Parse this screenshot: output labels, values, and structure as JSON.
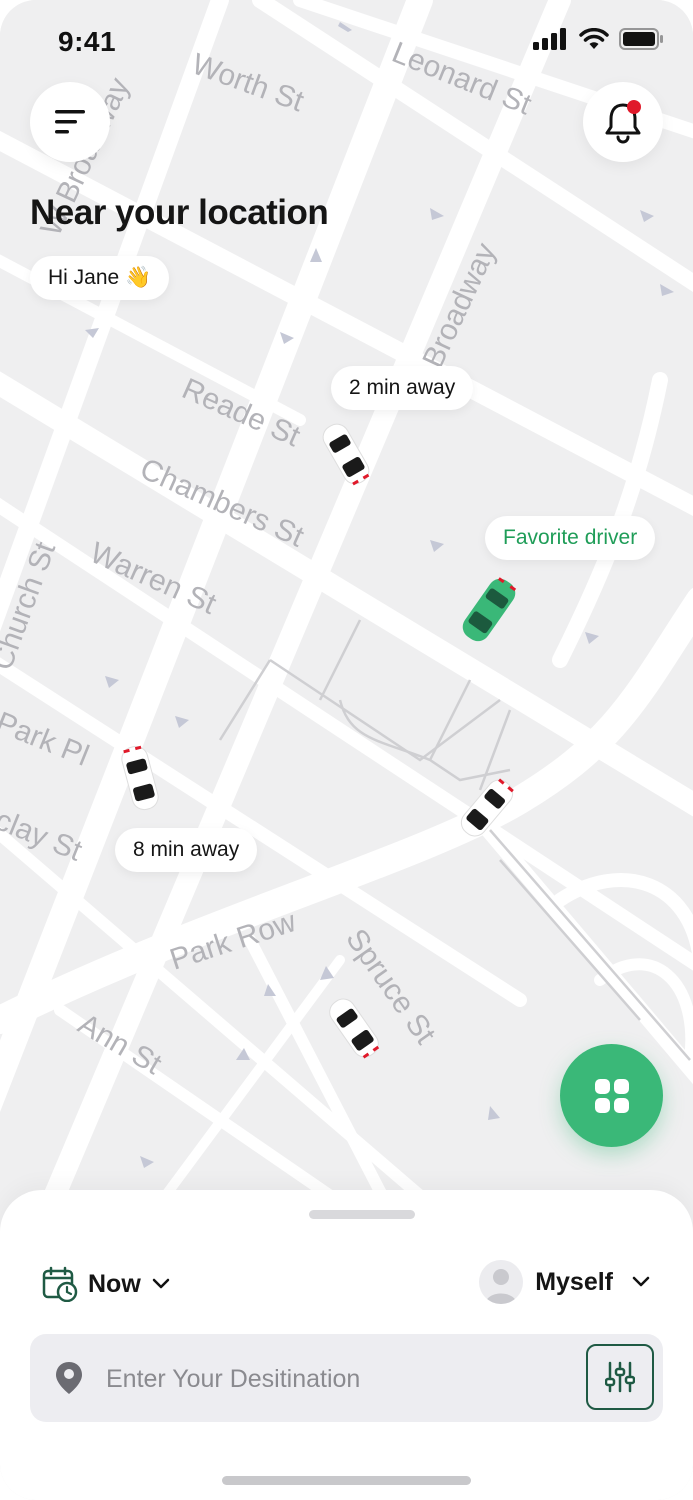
{
  "status_bar": {
    "time": "9:41"
  },
  "header": {
    "title": "Near your location",
    "greeting": "Hi Jane 👋"
  },
  "map": {
    "street_labels": [
      "Worth St",
      "Leonard St",
      "W Broadway",
      "Broadway",
      "Reade St",
      "Chambers St",
      "Warren St",
      "Church St",
      "Park Pl",
      "Barclay St",
      "Park Row",
      "Spruce St",
      "Ann St"
    ],
    "eta_badges": [
      "2 min away",
      "8 min away"
    ],
    "favorite_badge": "Favorite driver"
  },
  "sheet": {
    "when_label": "Now",
    "who_label": "Myself",
    "search_placeholder": "Enter Your Desitination"
  },
  "colors": {
    "accent": "#3ab878",
    "notification_dot": "#e0192a",
    "filter_border": "#1f5a44"
  },
  "icons": [
    "menu-icon",
    "bell-icon",
    "calendar-clock-icon",
    "chevron-down-icon",
    "location-pin-icon",
    "sliders-icon",
    "grid-icon"
  ]
}
